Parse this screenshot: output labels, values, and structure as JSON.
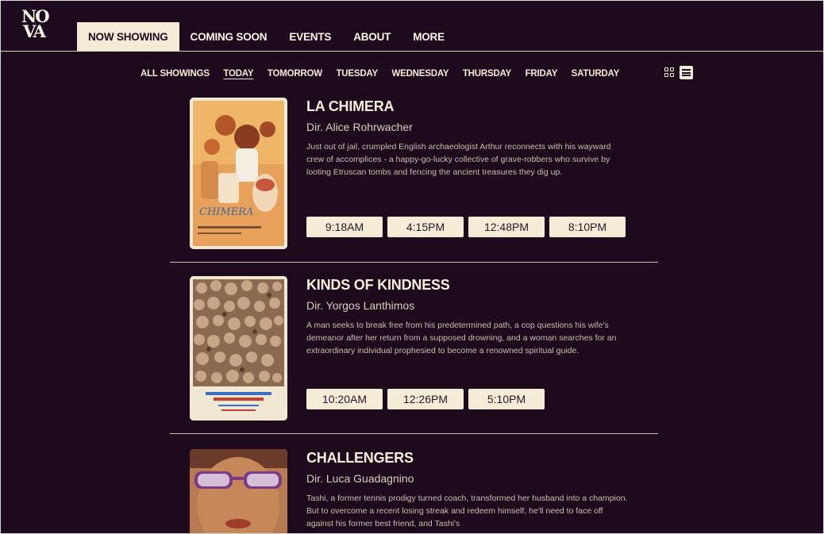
{
  "brand": {
    "logo_line1": "NO",
    "logo_line2": "VA"
  },
  "nav": {
    "items": [
      {
        "label": "NOW SHOWING",
        "active": true
      },
      {
        "label": "COMING SOON",
        "active": false
      },
      {
        "label": "EVENTS",
        "active": false
      },
      {
        "label": "ABOUT",
        "active": false
      },
      {
        "label": "MORE",
        "active": false
      }
    ]
  },
  "days": {
    "items": [
      {
        "label": "ALL SHOWINGS",
        "active": false
      },
      {
        "label": "TODAY",
        "active": true
      },
      {
        "label": "TOMORROW",
        "active": false
      },
      {
        "label": "TUESDAY",
        "active": false
      },
      {
        "label": "WEDNESDAY",
        "active": false
      },
      {
        "label": "THURSDAY",
        "active": false
      },
      {
        "label": "FRIDAY",
        "active": false
      },
      {
        "label": "SATURDAY",
        "active": false
      }
    ]
  },
  "view": {
    "selected": "list",
    "icons": [
      "grid-icon",
      "list-icon"
    ]
  },
  "films": [
    {
      "title": "LA CHIMERA",
      "director": "Dir. Alice Rohrwacher",
      "synopsis": "Just out of jail, crumpled English archaeologist Arthur reconnects with his wayward crew of accomplices - a happy-go-lucky collective of grave-robbers who survive by looting Etruscan tombs and fencing the ancient treasures they dig up.",
      "times": [
        "9:18AM",
        "4:15PM",
        "12:48PM",
        "8:10PM"
      ]
    },
    {
      "title": "KINDS OF KINDNESS",
      "director": "Dir. Yorgos Lanthimos",
      "synopsis": "A man seeks to break free from his predetermined path, a cop questions his wife's demeanor after her return from a supposed drowning, and a woman searches for an extraordinary individual prophesied to become a renowned spiritual guide.",
      "times": [
        "10:20AM",
        "12:26PM",
        "5:10PM"
      ]
    },
    {
      "title": "CHALLENGERS",
      "director": "Dir. Luca Guadagnino",
      "synopsis": "Tashi, a former tennis prodigy turned coach, transformed her husband into a champion. But to overcome a recent losing streak and redeem himself, he'll need to face off against his former best friend, and Tashi's",
      "times": []
    }
  ],
  "colors": {
    "background": "#1d0a1d",
    "cream": "#f5ecd7",
    "text": "#f3ead7"
  }
}
